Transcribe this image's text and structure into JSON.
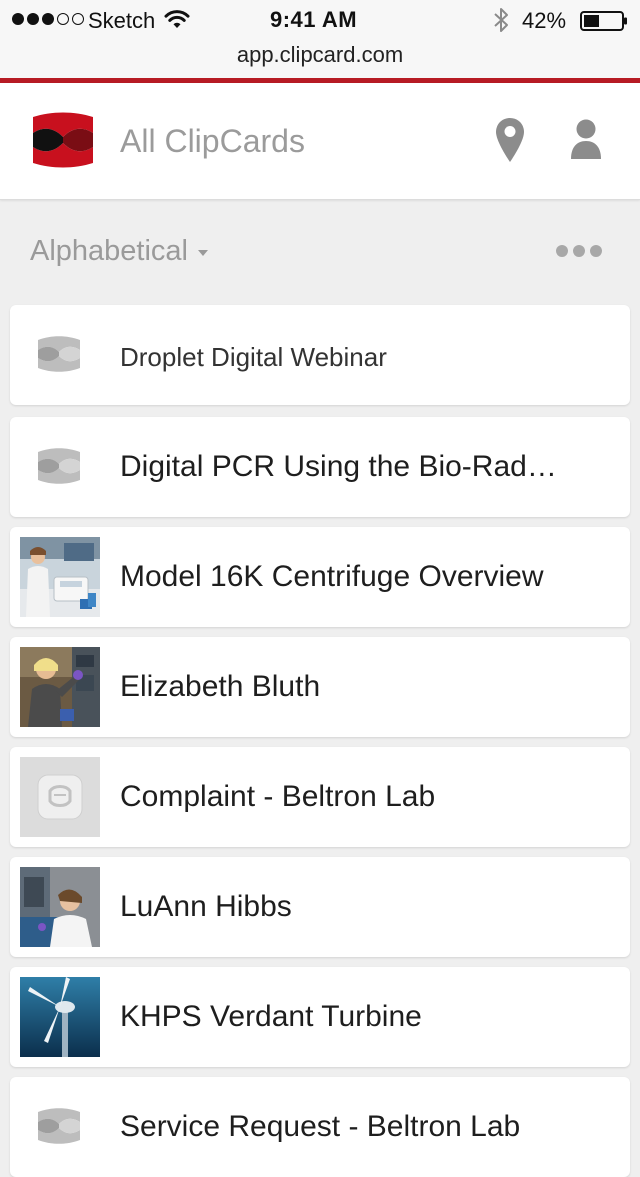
{
  "status_bar": {
    "carrier": "Sketch",
    "time": "9:41 AM",
    "battery": "42%",
    "battery_level": 0.42,
    "signal_bars_filled": 3,
    "signal_bars_total": 5
  },
  "browser": {
    "url": "app.clipcard.com"
  },
  "header": {
    "title": "All ClipCards",
    "icons": [
      "clipcard-logo",
      "location-pin-icon",
      "user-icon"
    ]
  },
  "sort": {
    "selected": "Alphabetical"
  },
  "cards": [
    {
      "title": "Droplet Digital Webinar",
      "thumb": "clipcard-glyph"
    },
    {
      "title": "Digital PCR Using the Bio-Rad…",
      "thumb": "clipcard-glyph"
    },
    {
      "title": "Model 16K Centrifuge Overview",
      "thumb": "photo-lab-centrifuge"
    },
    {
      "title": "Elizabeth Bluth",
      "thumb": "photo-lab-person"
    },
    {
      "title": "Complaint - Beltron Lab",
      "thumb": "clipcard-app-tile"
    },
    {
      "title": "LuAnn Hibbs",
      "thumb": "photo-lab-scientist"
    },
    {
      "title": "KHPS Verdant Turbine",
      "thumb": "photo-underwater-turbine"
    },
    {
      "title": "Service Request - Beltron Lab",
      "thumb": "clipcard-glyph"
    }
  ],
  "colors": {
    "accent_red": "#b71b24",
    "muted_gray": "#9b9b9b",
    "background": "#efefef"
  }
}
